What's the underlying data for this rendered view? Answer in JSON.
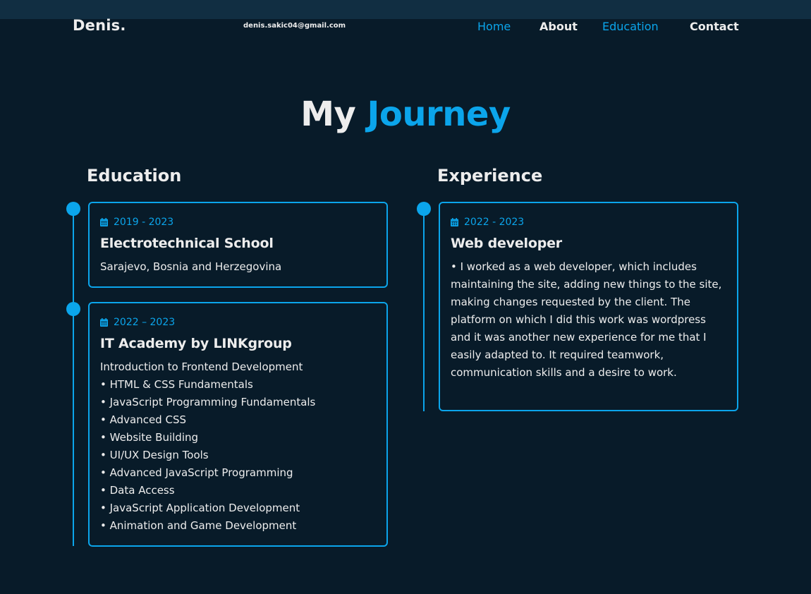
{
  "header": {
    "logo": "Denis.",
    "email": "denis.sakic04@gmail.com",
    "nav": [
      {
        "label": "Home",
        "active": true
      },
      {
        "label": "About",
        "active": false
      },
      {
        "label": "Education",
        "active": true
      },
      {
        "label": "Contact",
        "active": false
      }
    ]
  },
  "section": {
    "heading_main": "My",
    "heading_accent": "Journey"
  },
  "education": {
    "title": "Education",
    "items": [
      {
        "date": "2019 - 2023",
        "title": "Electrotechnical School",
        "lines": [
          "Sarajevo, Bosnia and Herzegovina"
        ]
      },
      {
        "date": "2022 – 2023",
        "title": "IT Academy by LINKgroup",
        "lines": [
          "Introduction to Frontend Development",
          "• HTML & CSS Fundamentals",
          "• JavaScript Programming Fundamentals",
          "• Advanced CSS",
          "• Website Building",
          "• UI/UX Design Tools",
          "• Advanced JavaScript Programming",
          "• Data Access",
          "• JavaScript Application Development",
          "• Animation and Game Development"
        ]
      }
    ]
  },
  "experience": {
    "title": "Experience",
    "items": [
      {
        "date": "2022 - 2023",
        "title": "Web developer",
        "description": "• I worked as a web developer, which includes maintaining the site, adding new things to the site, making changes requested by the client. The platform on which I did this work was wordpress and it was another new experience for me that I easily adapted to. It required teamwork, communication skills and a desire to work."
      }
    ]
  },
  "colors": {
    "background": "#081b29",
    "accent": "#0ba5eb",
    "text": "#ededed",
    "header_strip": "#112e42"
  },
  "icons": {
    "date": "calendar-icon"
  }
}
